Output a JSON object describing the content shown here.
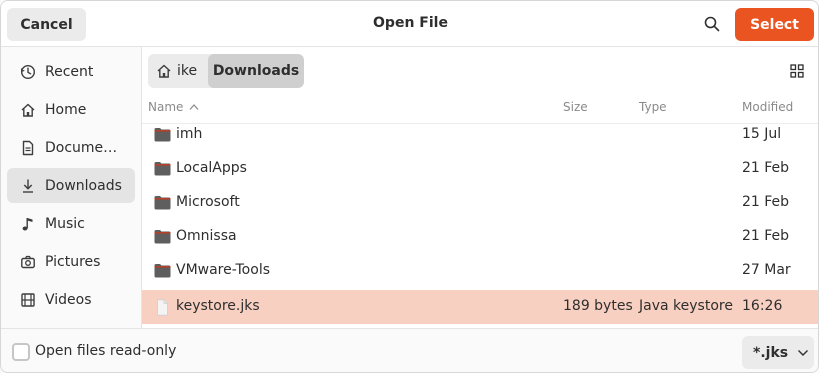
{
  "header": {
    "cancel_label": "Cancel",
    "title": "Open File",
    "select_label": "Select",
    "search_icon": "search-icon",
    "accent": "#e95420"
  },
  "sidebar": {
    "items": [
      {
        "label": "Recent",
        "icon": "clock-icon"
      },
      {
        "label": "Home",
        "icon": "home-icon"
      },
      {
        "label": "Docume…",
        "icon": "document-icon"
      },
      {
        "label": "Downloads",
        "icon": "download-icon",
        "active": true
      },
      {
        "label": "Music",
        "icon": "music-icon"
      },
      {
        "label": "Pictures",
        "icon": "camera-icon"
      },
      {
        "label": "Videos",
        "icon": "film-icon"
      }
    ]
  },
  "pathbar": {
    "home_label": "ike",
    "current_label": "Downloads"
  },
  "columns": {
    "name": "Name",
    "size": "Size",
    "type": "Type",
    "modified": "Modified"
  },
  "files": [
    {
      "name": "imh",
      "size": "",
      "type": "",
      "modified": "15 Jul",
      "kind": "folder"
    },
    {
      "name": "LocalApps",
      "size": "",
      "type": "",
      "modified": "21 Feb",
      "kind": "folder"
    },
    {
      "name": "Microsoft",
      "size": "",
      "type": "",
      "modified": "21 Feb",
      "kind": "folder"
    },
    {
      "name": "Omnissa",
      "size": "",
      "type": "",
      "modified": "21 Feb",
      "kind": "folder"
    },
    {
      "name": "VMware-Tools",
      "size": "",
      "type": "",
      "modified": "27 Mar",
      "kind": "folder"
    },
    {
      "name": "keystore.jks",
      "size": "189 bytes",
      "type": "Java keystore",
      "modified": "16:26",
      "kind": "file",
      "selected": true
    }
  ],
  "footer": {
    "readonly_label": "Open files read-only",
    "readonly_checked": false,
    "filter_label": "*.jks"
  }
}
